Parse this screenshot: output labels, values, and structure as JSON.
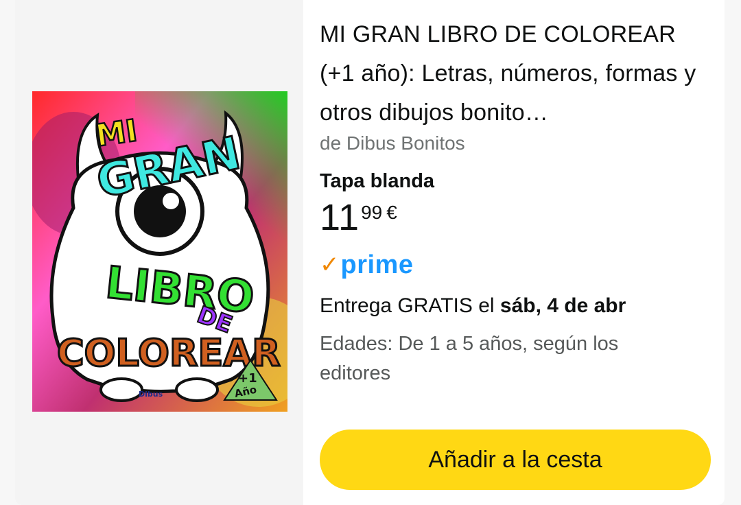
{
  "product": {
    "title": "MI GRAN LIBRO DE COLOREAR (+1 año): Letras, números, formas y otros dibujos bonito…",
    "author": "de Dibus Bonitos",
    "format": "Tapa blanda",
    "price": {
      "whole": "11",
      "cents": "99",
      "currency": "€"
    },
    "prime": {
      "check": "✓",
      "label": "prime"
    },
    "delivery": {
      "prefix": "Entrega GRATIS el ",
      "date": "sáb, 4 de abr"
    },
    "ages": "Edades: De 1 a 5 años, según los editores",
    "add_to_cart_label": "Añadir a la cesta"
  },
  "cover": {
    "lines": [
      "MI",
      "GRAN",
      "LIBRO",
      "DE",
      "COLOREAR"
    ],
    "badge_top": "+1",
    "badge_bottom": "Año",
    "publisher_logo": "Dibus"
  },
  "colors": {
    "button": "#ffd814",
    "prime_blue": "#1a98ff",
    "prime_check": "#f08804"
  }
}
